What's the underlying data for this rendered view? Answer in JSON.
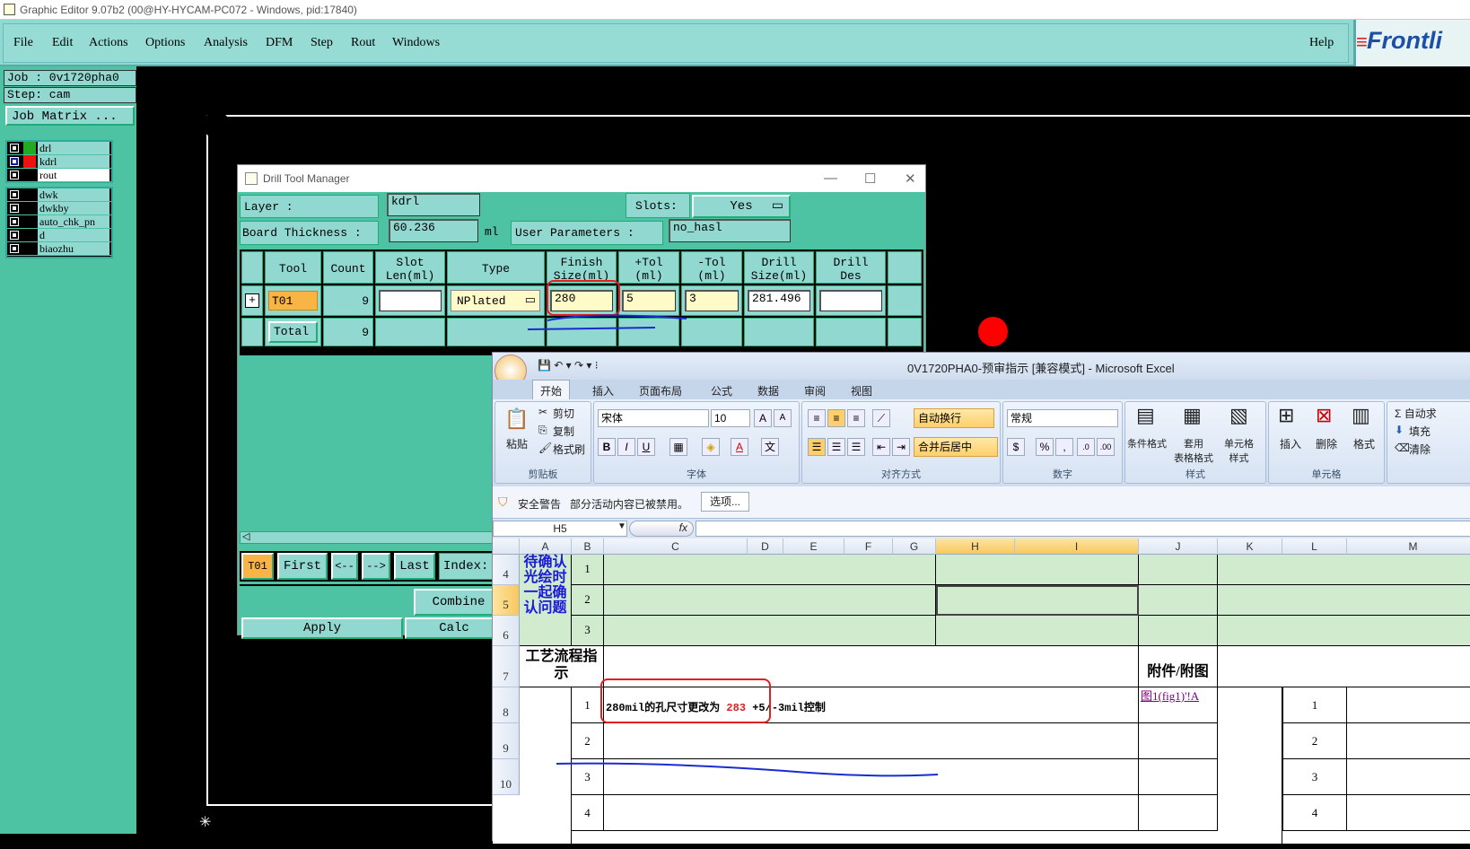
{
  "window": {
    "title": "Graphic Editor 9.07b2 (00@HY-HYCAM-PC072 - Windows, pid:17840)"
  },
  "menu": {
    "items": [
      "File",
      "Edit",
      "Actions",
      "Options",
      "Analysis",
      "DFM",
      "Step",
      "Rout",
      "Windows"
    ],
    "help": "Help",
    "logo": "Frontli"
  },
  "left": {
    "job": "Job : 0v1720pha0",
    "step": "Step: cam",
    "job_matrix": "Job Matrix ...",
    "layers_top": [
      {
        "name": "drl",
        "color": "#22aa22"
      },
      {
        "name": "kdrl",
        "color": "#ee1111"
      },
      {
        "name": "rout",
        "color": "#000000"
      }
    ],
    "layers_bottom": [
      "dwk",
      "dwkby",
      "auto_chk_pn",
      "d",
      "biaozhu"
    ]
  },
  "dtm": {
    "title": "Drill Tool Manager",
    "layer_label": "Layer         :",
    "layer_value": "kdrl",
    "slots_label": "Slots:",
    "slots_value": "Yes",
    "thickness_label": "Board Thickness :",
    "thickness_value": "60.236",
    "thickness_unit": "ml",
    "user_params_label": "User Parameters :",
    "user_params_value": "no_hasl",
    "headers": [
      "Tool",
      "Count",
      "Slot\nLen(ml)",
      "Type",
      "Finish\nSize(ml)",
      "+Tol\n(ml)",
      "-Tol\n(ml)",
      "Drill\nSize(ml)",
      "Drill\nDes"
    ],
    "row": {
      "tool": "T01",
      "count": "9",
      "type": "NPlated",
      "finish": "280",
      "ptol": "5",
      "ntol": "3",
      "drill": "281.496"
    },
    "total": {
      "label": "Total",
      "count": "9"
    },
    "nav": {
      "current": "T01",
      "first": "First",
      "prev": "<--",
      "next": "-->",
      "last": "Last",
      "index": "Index:"
    },
    "combine": "Combine",
    "apply": "Apply",
    "calc": "Calc"
  },
  "excel": {
    "title": "0V1720PHA0-预审指示  [兼容模式] - Microsoft Excel",
    "tabs": [
      "开始",
      "插入",
      "页面布局",
      "公式",
      "数据",
      "审阅",
      "视图"
    ],
    "clipboard": {
      "paste": "粘贴",
      "cut": "剪切",
      "copy": "复制",
      "format_painter": "格式刷",
      "label": "剪贴板"
    },
    "font": {
      "name": "宋体",
      "size": "10",
      "label": "字体",
      "bold": "B",
      "italic": "I",
      "underline": "U"
    },
    "align": {
      "wrap": "自动换行",
      "merge": "合并后居中",
      "label": "对齐方式"
    },
    "number": {
      "format": "常规",
      "label": "数字",
      "percent": "%",
      "comma": ","
    },
    "styles": {
      "cond": "条件格式",
      "table": "套用\n表格格式",
      "cell": "单元格\n样式",
      "label": "样式"
    },
    "cells": {
      "insert": "插入",
      "delete": "删除",
      "format": "格式",
      "label": "单元格"
    },
    "editing": {
      "autosum": "Σ 自动求",
      "fill": "填充",
      "clear": "清除"
    },
    "warning": {
      "title": "安全警告",
      "text": "部分活动内容已被禁用。",
      "button": "选项..."
    },
    "namebox": "H5",
    "fx": "fx",
    "columns": [
      "A",
      "B",
      "C",
      "D",
      "E",
      "F",
      "G",
      "H",
      "I",
      "J",
      "K",
      "L",
      "M"
    ],
    "rows": [
      "4",
      "5",
      "6",
      "7",
      "8",
      "9",
      "10"
    ],
    "a_text": "待确认光绘时一起确认问题",
    "b_vals": [
      "1",
      "2",
      "3"
    ],
    "process_title": "工艺流程指示",
    "attach_title": "附件/附图",
    "line1_num": "1",
    "line1_text_a": "280mil的孔尺寸更改为 ",
    "line1_text_b": "283",
    "line1_text_c": " +5/-3mil控制",
    "link": "图1(fig1)'!A",
    "l_vals": [
      "1",
      "2",
      "3",
      "4"
    ],
    "b_lower": [
      "1",
      "2",
      "3",
      "4"
    ]
  }
}
